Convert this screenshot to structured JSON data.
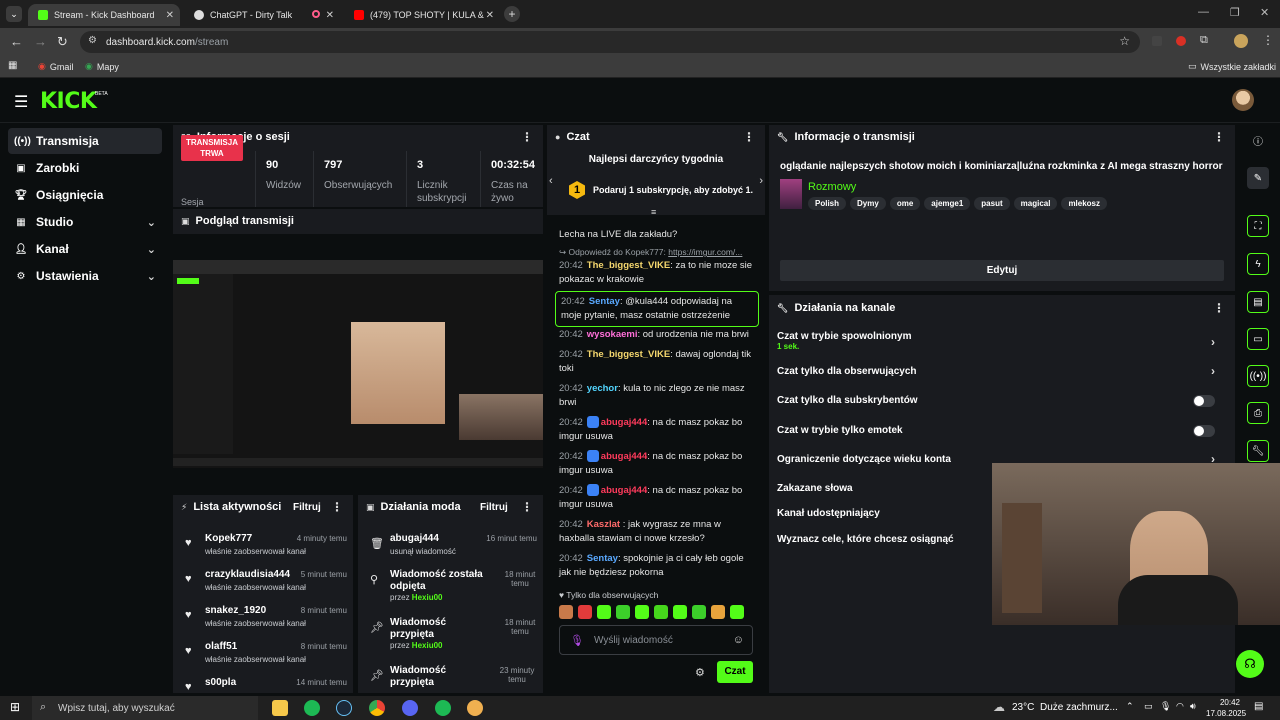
{
  "browser": {
    "tabs": [
      {
        "title": "Stream - Kick Dashboard"
      },
      {
        "title": "ChatGPT - Dirty Talk"
      },
      {
        "title": "(479) TOP SHOTY | KULA &"
      }
    ],
    "url_domain": "dashboard.kick.com",
    "url_path": "/stream",
    "bookmarks": [
      "Gmail",
      "Mapy"
    ],
    "all_bookmarks": "Wszystkie zakładki"
  },
  "kick": {
    "logo": "KICK",
    "beta": "BETA"
  },
  "sidebar": {
    "items": [
      {
        "label": "Transmisja"
      },
      {
        "label": "Zarobki"
      },
      {
        "label": "Osiągnięcia"
      },
      {
        "label": "Studio"
      },
      {
        "label": "Kanał"
      },
      {
        "label": "Ustawienia"
      }
    ]
  },
  "session": {
    "title": "Informacje o sesji",
    "live_badge": "TRANSMISJA TRWA",
    "live_sub": "Sesja",
    "stats": [
      {
        "value": "90",
        "label": "Widzów"
      },
      {
        "value": "797",
        "label": "Obserwujących"
      },
      {
        "value": "3",
        "label": "Licznik subskrypcji"
      },
      {
        "value": "00:32:54",
        "label": "Czas na żywo"
      }
    ]
  },
  "preview": {
    "title": "Podgląd transmisji"
  },
  "activity": {
    "title": "Lista aktywności",
    "filter": "Filtruj",
    "items": [
      {
        "user": "Kopek777",
        "action": "właśnie zaobserwował kanał",
        "time": "4 minuty temu"
      },
      {
        "user": "crazyklaudisia444",
        "action": "właśnie zaobserwował kanał",
        "time": "5 minut temu"
      },
      {
        "user": "snakez_1920",
        "action": "właśnie zaobserwował kanał",
        "time": "8 minut temu"
      },
      {
        "user": "olaff51",
        "action": "właśnie zaobserwował kanał",
        "time": "8 minut temu"
      },
      {
        "user": "s00pla",
        "action": "",
        "time": "14 minut temu"
      }
    ]
  },
  "mods": {
    "title": "Działania moda",
    "filter": "Filtruj",
    "items": [
      {
        "title": "abugaj444",
        "detail": "usunął wiadomość",
        "by": "",
        "time": "16 minut temu"
      },
      {
        "title": "Wiadomość została odpięta",
        "detail": "przez",
        "by": "Hexiu00",
        "time": "18 minut temu"
      },
      {
        "title": "Wiadomość przypięta",
        "detail": "przez",
        "by": "Hexiu00",
        "time": "18 minut temu"
      },
      {
        "title": "Wiadomość przypięta",
        "detail": "przez",
        "by": "Hexiu00",
        "time": "23 minuty temu"
      }
    ]
  },
  "chat": {
    "title": "Czat",
    "best_donors": "Najlepsi darczyńcy tygodnia",
    "gift_prompt": "Podaruj 1 subskrypcję, aby zdobyć 1.",
    "rank": "1",
    "pinned_text": "Lecha na LIVE dla zakładu?",
    "reply_to": "Odpowiedź do Kopek777:",
    "reply_link": "https://imgur.com/...",
    "messages": [
      {
        "time": "20:42",
        "user": "The_biggest_VIKE",
        "color": "#f5d76e",
        "text": "za to nie moze sie pokazac w krakowie"
      },
      {
        "time": "20:42",
        "user": "Sentay",
        "color": "#5aa9ff",
        "text": "@kula444 odpowiadaj na moje pytanie, masz ostatnie ostrzeżenie"
      },
      {
        "time": "20:42",
        "user": "wysokaemi",
        "color": "#ff6fd8",
        "text": "od urodzenia nie ma brwi"
      },
      {
        "time": "20:42",
        "user": "The_biggest_VIKE",
        "color": "#f5d76e",
        "text": "dawaj oglondaj tik toki"
      },
      {
        "time": "20:42",
        "user": "yechor",
        "color": "#53d6ff",
        "text": "kula to nic zlego ze nie masz brwi"
      },
      {
        "time": "20:42",
        "user": "abugaj444",
        "color": "#ff3b5c",
        "text": "na dc masz pokaz bo imgur usuwa"
      },
      {
        "time": "20:42",
        "user": "abugaj444",
        "color": "#ff3b5c",
        "text": "na dc masz pokaz bo imgur usuwa"
      },
      {
        "time": "20:42",
        "user": "abugaj444",
        "color": "#ff3b5c",
        "text": "na dc masz pokaz bo imgur usuwa"
      },
      {
        "time": "20:42",
        "user": "Kaszlat",
        "color": "#ff6b6b",
        "text": ": jak wygrasz ze mna w haxballa stawiam ci nowe krzesło?"
      },
      {
        "time": "20:42",
        "user": "Sentay",
        "color": "#5aa9ff",
        "text": "spokojnie ja ci cały łeb ogole jak nie będziesz pokorna"
      }
    ],
    "followers_only": "Tylko dla obserwujących",
    "input_placeholder": "Wyślij wiadomość",
    "send": "Czat"
  },
  "stream_info": {
    "title": "Informacje o transmisji",
    "stream_title": "oglądanie najlepszych shotow moich i kominiarza|luźna rozkminka z AI mega straszny horror",
    "category": "Rozmowy",
    "tags": [
      "Polish",
      "Dymy",
      "ome",
      "ajemge1",
      "pasut",
      "magical",
      "mlekosz"
    ],
    "edit": "Edytuj"
  },
  "channel_actions": {
    "title": "Działania na kanale",
    "items": [
      {
        "label": "Czat w trybie spowolnionym",
        "sub": "1 sek.",
        "control": "arrow"
      },
      {
        "label": "Czat tylko dla obserwujących",
        "sub": "",
        "control": "arrow"
      },
      {
        "label": "Czat tylko dla subskrybentów",
        "sub": "",
        "control": "toggle"
      },
      {
        "label": "Czat w trybie tylko emotek",
        "sub": "",
        "control": "toggle"
      },
      {
        "label": "Ograniczenie dotyczące wieku konta",
        "sub": "",
        "control": "arrow"
      },
      {
        "label": "Zakazane słowa",
        "sub": "",
        "control": "none"
      },
      {
        "label": "Kanał udostępniający",
        "sub": "",
        "control": "none"
      },
      {
        "label": "Wyznacz cele, które chcesz osiągnąć",
        "sub": "",
        "control": "none"
      }
    ]
  },
  "taskbar": {
    "search": "Wpisz tutaj, aby wyszukać",
    "weather_temp": "23°C",
    "weather_text": "Duże zachmurz...",
    "clock_time": "20:42",
    "clock_date": "17.08.2025"
  },
  "colors": {
    "accent": "#53fc18",
    "live": "#e8324b",
    "panel": "#191b1f",
    "bg": "#0b0e0f"
  }
}
